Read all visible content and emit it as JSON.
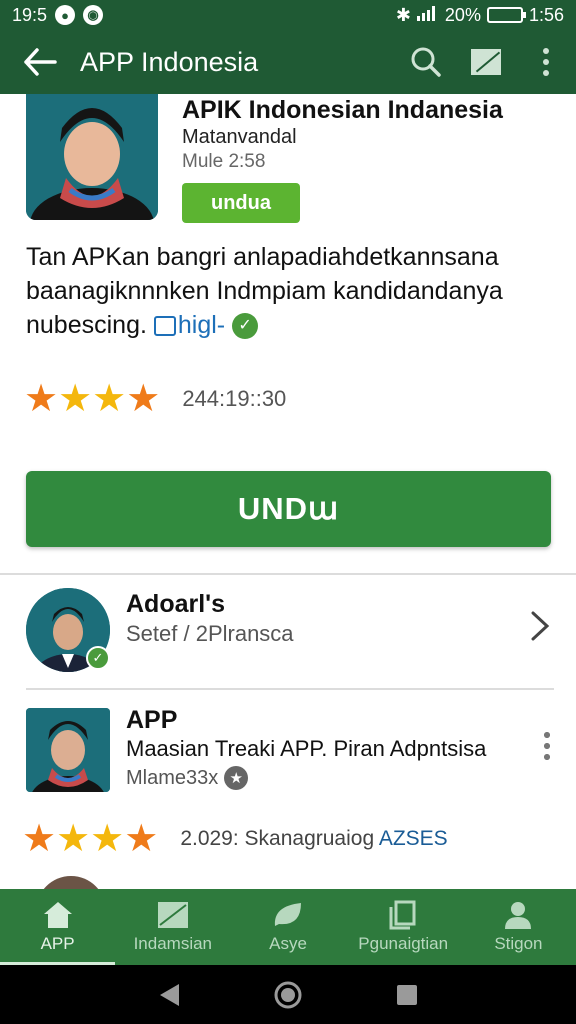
{
  "status_bar": {
    "time": "19:5",
    "battery_percent": "20%",
    "clock_right": "1:56",
    "battery_level": 0.2
  },
  "app_bar": {
    "title": "APP Indonesia",
    "icons": [
      "back-arrow-icon",
      "search-icon",
      "edit-icon",
      "more-vert-icon"
    ]
  },
  "featured": {
    "title": "APIK Indonesian Indanesia",
    "developer": "Matanvandal",
    "meta": "Mule 2:58",
    "small_button": "undua",
    "description": "Tan APKan bangri anlapadiahdetkannsana baanagiknnnken Indmpiam kandidandanya nubescing.",
    "description_link": "higl-",
    "rating": 4,
    "rating_text": "244:19::30",
    "main_button": "UNDա"
  },
  "list": [
    {
      "title": "Adoarl's",
      "subtitle": "Setef / 2Plransca",
      "verified": true
    },
    {
      "title": "APP",
      "description": "Maasian Treaki APP. Piran Adpntsisa",
      "meta": "Mlame33x",
      "rating": 4,
      "rating_text": "2.029: Skanagruaiog",
      "rating_accent": "AZSES"
    }
  ],
  "bottom_nav": [
    {
      "label": "APP",
      "icon": "home-icon",
      "active": true
    },
    {
      "label": "Indamsian",
      "icon": "category-icon",
      "active": false
    },
    {
      "label": "Asye",
      "icon": "leaf-icon",
      "active": false
    },
    {
      "label": "Pgunaigtian",
      "icon": "library-icon",
      "active": false
    },
    {
      "label": "Stigon",
      "icon": "person-icon",
      "active": false
    }
  ],
  "colors": {
    "primary_dark": "#1f5a34",
    "primary": "#318a3e",
    "accent_green": "#5cb431",
    "star_orange": "#ef7b1a",
    "star_yellow": "#f4b70d"
  }
}
